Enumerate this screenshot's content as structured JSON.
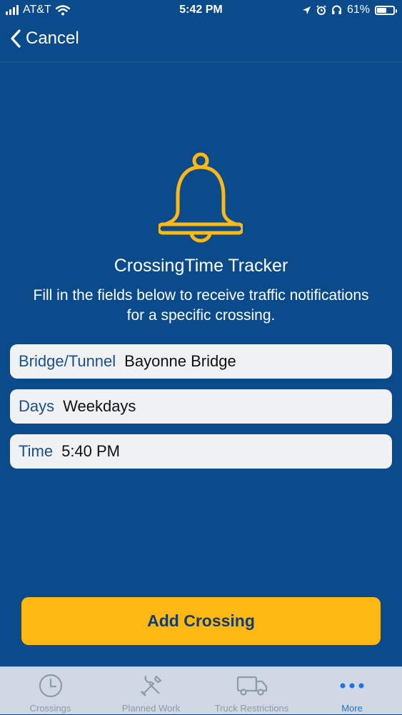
{
  "status_bar": {
    "carrier": "AT&T",
    "time": "5:42 PM",
    "battery_percent": "61%",
    "battery_level": 0.61,
    "icons": [
      "signal-icon",
      "wifi-icon",
      "location-icon",
      "alarm-icon",
      "headphones-icon",
      "battery-icon"
    ]
  },
  "nav": {
    "cancel_label": "Cancel"
  },
  "main": {
    "icon": "bell-icon",
    "title": "CrossingTime Tracker",
    "subtitle_line1": "Fill in the fields below to receive traffic notifications",
    "subtitle_line2": "for a specific crossing.",
    "fields": [
      {
        "label": "Bridge/Tunnel",
        "value": "Bayonne Bridge"
      },
      {
        "label": "Days",
        "value": "Weekdays"
      },
      {
        "label": "Time",
        "value": "5:40 PM"
      }
    ],
    "add_button_label": "Add Crossing"
  },
  "tabs": [
    {
      "label": "Crossings",
      "icon": "clock-icon",
      "active": false
    },
    {
      "label": "Planned Work",
      "icon": "tools-icon",
      "active": false
    },
    {
      "label": "Truck Restrictions",
      "icon": "truck-icon",
      "active": false
    },
    {
      "label": "More",
      "icon": "more-icon",
      "active": true
    }
  ],
  "colors": {
    "background": "#0b4a8b",
    "accent": "#fdb813",
    "tab_bar": "#cfd8e3",
    "tab_active": "#1a73e8"
  }
}
